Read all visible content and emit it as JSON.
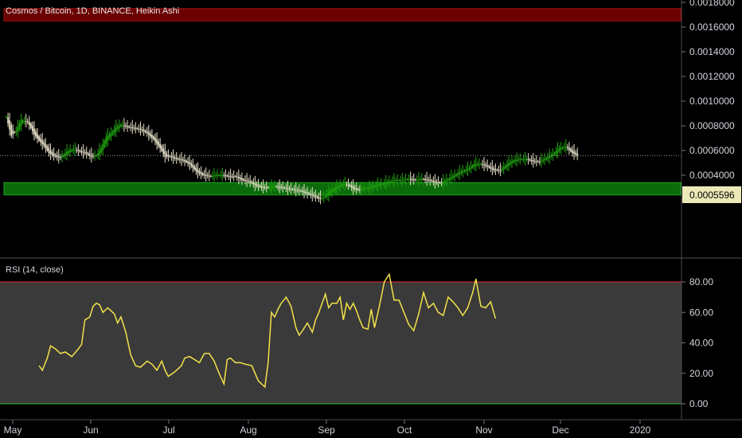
{
  "chart_title": "Cosmos / Bitcoin, 1D, BINANCE, Heikin Ashi",
  "price_label": "0.0005596",
  "colors": {
    "up": "#1fa30f",
    "down": "#e8e1c8",
    "resistance_zone": "#6b0000",
    "support_zone": "#0b6b0b",
    "rsi_line": "#f3e24a",
    "rsi_band_bg": "#3a3a3a",
    "rsi_upper_line": "#e0302e",
    "rsi_lower_line": "#2ec42e",
    "price_tag_bg": "#ece9b8"
  },
  "chart_data": [
    {
      "type": "candlestick",
      "title": "Cosmos / Bitcoin, 1D, BINANCE, Heikin Ashi",
      "ylim": [
        0.00018,
        0.00181
      ],
      "y_ticks": [
        "0.0018000",
        "0.0016000",
        "0.0014000",
        "0.0012000",
        "0.0010000",
        "0.0008000",
        "0.0006000",
        "0.0004000",
        "0.0002000"
      ],
      "x_ticks": [
        "May",
        "Jun",
        "Jul",
        "Aug",
        "Sep",
        "Oct",
        "Nov",
        "Dec",
        "2020"
      ],
      "last_price": 0.0005596,
      "zones": [
        {
          "name": "resistance",
          "from": 0.00165,
          "to": 0.00175
        },
        {
          "name": "support",
          "from": 0.00024,
          "to": 0.00034
        }
      ],
      "close_path": [
        [
          0,
          0.00087
        ],
        [
          3,
          0.00072
        ],
        [
          6,
          0.00076
        ],
        [
          9,
          0.00085
        ],
        [
          13,
          0.00083
        ],
        [
          17,
          0.00073
        ],
        [
          20,
          0.00068
        ],
        [
          23,
          0.00064
        ],
        [
          26,
          0.00058
        ],
        [
          30,
          0.00055
        ],
        [
          33,
          0.00054
        ],
        [
          37,
          0.00059
        ],
        [
          41,
          0.00061
        ],
        [
          45,
          0.00059
        ],
        [
          48,
          0.00058
        ],
        [
          52,
          0.00055
        ],
        [
          55,
          0.00056
        ],
        [
          58,
          0.00062
        ],
        [
          61,
          0.00071
        ],
        [
          64,
          0.00074
        ],
        [
          67,
          0.00079
        ],
        [
          70,
          0.00081
        ],
        [
          74,
          0.00079
        ],
        [
          78,
          0.00078
        ],
        [
          82,
          0.00077
        ],
        [
          86,
          0.00074
        ],
        [
          90,
          0.00069
        ],
        [
          94,
          0.00062
        ],
        [
          97,
          0.00055
        ],
        [
          100,
          0.00055
        ],
        [
          104,
          0.00053
        ],
        [
          108,
          0.00052
        ],
        [
          112,
          0.00049
        ],
        [
          116,
          0.00043
        ],
        [
          120,
          0.0004
        ],
        [
          124,
          0.00039
        ],
        [
          128,
          0.0004
        ],
        [
          132,
          0.0004
        ],
        [
          136,
          0.00039
        ],
        [
          140,
          0.00039
        ],
        [
          144,
          0.00036
        ],
        [
          148,
          0.00035
        ],
        [
          152,
          0.00032
        ],
        [
          156,
          0.0003
        ],
        [
          160,
          0.0003
        ],
        [
          164,
          0.00031
        ],
        [
          168,
          0.0003
        ],
        [
          172,
          0.00029
        ],
        [
          176,
          0.00028
        ],
        [
          180,
          0.00027
        ],
        [
          184,
          0.00025
        ],
        [
          188,
          0.00023
        ],
        [
          191,
          0.00021
        ],
        [
          194,
          0.00022
        ],
        [
          197,
          0.00026
        ],
        [
          200,
          0.00029
        ],
        [
          203,
          0.00031
        ],
        [
          206,
          0.00033
        ],
        [
          209,
          0.00032
        ],
        [
          212,
          0.00029
        ],
        [
          215,
          0.00028
        ],
        [
          218,
          0.00029
        ],
        [
          222,
          0.0003
        ],
        [
          226,
          0.00032
        ],
        [
          230,
          0.00033
        ],
        [
          234,
          0.00035
        ],
        [
          238,
          0.00036
        ],
        [
          242,
          0.00036
        ],
        [
          246,
          0.00037
        ],
        [
          250,
          0.00036
        ],
        [
          254,
          0.00037
        ],
        [
          258,
          0.00036
        ],
        [
          262,
          0.00034
        ],
        [
          266,
          0.00034
        ],
        [
          270,
          0.00037
        ],
        [
          274,
          0.0004
        ],
        [
          278,
          0.00043
        ],
        [
          282,
          0.00045
        ],
        [
          286,
          0.00049
        ],
        [
          290,
          0.00049
        ],
        [
          294,
          0.00047
        ],
        [
          298,
          0.00044
        ],
        [
          302,
          0.00044
        ],
        [
          306,
          0.00049
        ],
        [
          310,
          0.00052
        ],
        [
          314,
          0.00053
        ],
        [
          318,
          0.00053
        ],
        [
          322,
          0.00051
        ],
        [
          326,
          0.00051
        ],
        [
          330,
          0.00054
        ],
        [
          334,
          0.00057
        ],
        [
          338,
          0.00062
        ],
        [
          342,
          0.00063
        ],
        [
          346,
          0.00058
        ],
        [
          349,
          0.00056
        ]
      ]
    },
    {
      "type": "line",
      "title": "RSI (14, close)",
      "ylim": [
        0,
        80
      ],
      "y_ticks": [
        "80.00",
        "60.00",
        "40.00",
        "20.00",
        "0.00"
      ],
      "bands": [
        80,
        0
      ],
      "x_ticks": [
        "May",
        "Jun",
        "Jul",
        "Aug",
        "Sep",
        "Oct",
        "Nov",
        "Dec",
        "2020"
      ],
      "series": [
        {
          "values": [
            [
              20,
              25
            ],
            [
              22,
              22
            ],
            [
              25,
              30
            ],
            [
              27,
              38
            ],
            [
              30,
              36
            ],
            [
              33,
              33
            ],
            [
              36,
              34
            ],
            [
              40,
              31
            ],
            [
              44,
              36
            ],
            [
              46,
              39
            ],
            [
              48,
              55
            ],
            [
              51,
              57
            ],
            [
              53,
              64
            ],
            [
              55,
              66
            ],
            [
              57,
              65
            ],
            [
              59,
              60
            ],
            [
              62,
              63
            ],
            [
              64,
              61
            ],
            [
              66,
              59
            ],
            [
              68,
              53
            ],
            [
              70,
              57
            ],
            [
              73,
              47
            ],
            [
              76,
              32
            ],
            [
              79,
              25
            ],
            [
              82,
              24
            ],
            [
              86,
              28
            ],
            [
              89,
              26
            ],
            [
              92,
              22
            ],
            [
              95,
              28
            ],
            [
              97,
              22
            ],
            [
              99,
              18
            ],
            [
              103,
              21
            ],
            [
              107,
              25
            ],
            [
              109,
              30
            ],
            [
              112,
              31
            ],
            [
              115,
              29
            ],
            [
              118,
              27
            ],
            [
              121,
              33
            ],
            [
              124,
              33
            ],
            [
              127,
              28
            ],
            [
              130,
              20
            ],
            [
              133,
              13
            ],
            [
              135,
              29
            ],
            [
              137,
              30
            ],
            [
              140,
              27
            ],
            [
              143,
              27
            ],
            [
              146,
              26
            ],
            [
              150,
              25
            ],
            [
              154,
              15
            ],
            [
              158,
              11
            ],
            [
              160,
              27
            ],
            [
              162,
              60
            ],
            [
              164,
              57
            ],
            [
              166,
              62
            ],
            [
              168,
              66
            ],
            [
              171,
              70
            ],
            [
              174,
              64
            ],
            [
              177,
              50
            ],
            [
              179,
              45
            ],
            [
              181,
              48
            ],
            [
              184,
              53
            ],
            [
              187,
              47
            ],
            [
              189,
              55
            ],
            [
              191,
              60
            ],
            [
              193,
              66
            ],
            [
              195,
              72
            ],
            [
              197,
              63
            ],
            [
              199,
              66
            ],
            [
              202,
              66
            ],
            [
              204,
              70
            ],
            [
              206,
              55
            ],
            [
              208,
              66
            ],
            [
              210,
              62
            ],
            [
              212,
              66
            ],
            [
              214,
              61
            ],
            [
              216,
              55
            ],
            [
              218,
              50
            ],
            [
              221,
              49
            ],
            [
              223,
              62
            ],
            [
              225,
              50
            ],
            [
              228,
              64
            ],
            [
              231,
              80
            ],
            [
              234,
              85
            ],
            [
              237,
              68
            ],
            [
              240,
              68
            ],
            [
              243,
              60
            ],
            [
              246,
              52
            ],
            [
              249,
              48
            ],
            [
              252,
              59
            ],
            [
              255,
              73
            ],
            [
              258,
              63
            ],
            [
              261,
              66
            ],
            [
              264,
              60
            ],
            [
              267,
              58
            ],
            [
              270,
              70
            ],
            [
              273,
              67
            ],
            [
              276,
              63
            ],
            [
              279,
              58
            ],
            [
              282,
              63
            ],
            [
              285,
              73
            ],
            [
              287,
              82
            ],
            [
              290,
              64
            ],
            [
              293,
              63
            ],
            [
              296,
              67
            ],
            [
              299,
              56
            ]
          ]
        }
      ]
    }
  ]
}
